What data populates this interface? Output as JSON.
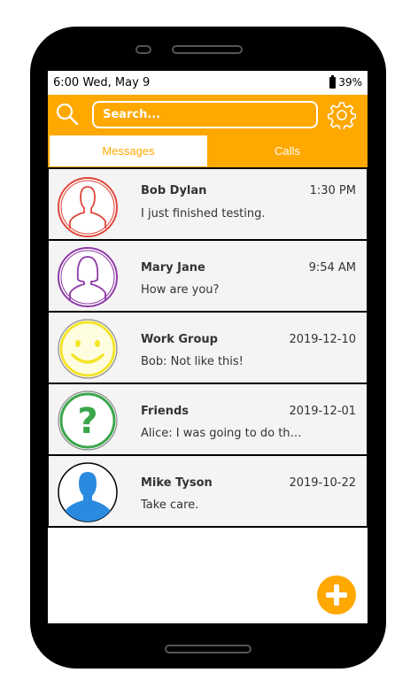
{
  "status": {
    "time": "6:00  Wed, May 9",
    "battery": "39%"
  },
  "search": {
    "placeholder": "Search..."
  },
  "tabs": {
    "messages": "Messages",
    "calls": "Calls"
  },
  "conversations": [
    {
      "name": "Bob Dylan",
      "time": "1:30 PM",
      "preview": "I just finished testing.",
      "avatar": "male-person-icon",
      "color": "#e0463a"
    },
    {
      "name": "Mary Jane",
      "time": "9:54 AM",
      "preview": "How are you?",
      "avatar": "female-person-icon",
      "color": "#8e3aa6"
    },
    {
      "name": "Work Group",
      "time": "2019-12-10",
      "preview": "Bob: Not like this!",
      "avatar": "smiley-icon",
      "color": "#f4e42a"
    },
    {
      "name": "Friends",
      "time": "2019-12-01",
      "preview": "Alice: I was going to do tha...",
      "avatar": "question-mark-icon",
      "color": "#3aa64a"
    },
    {
      "name": "Mike Tyson",
      "time": "2019-10-22",
      "preview": "Take care.",
      "avatar": "person-silhouette-icon",
      "color": "#2a8ae0"
    }
  ],
  "colors": {
    "accent": "#ffa800"
  }
}
